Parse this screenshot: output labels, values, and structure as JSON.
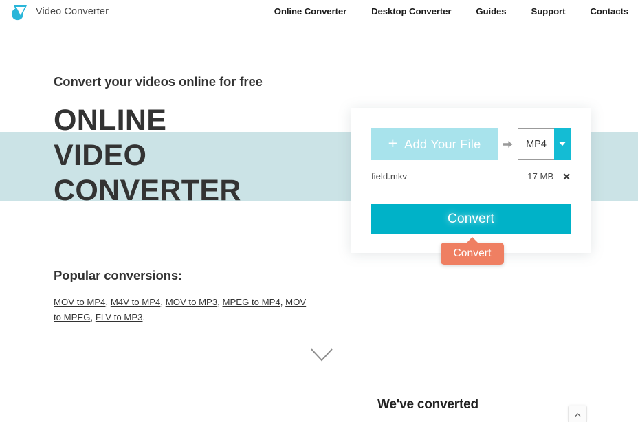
{
  "header": {
    "brand_name": "Video Converter",
    "logo_icon": "video-converter-logo",
    "nav": [
      {
        "label": "Online Converter"
      },
      {
        "label": "Desktop Converter"
      },
      {
        "label": "Guides"
      },
      {
        "label": "Support"
      },
      {
        "label": "Contacts"
      }
    ]
  },
  "hero": {
    "kicker": "Convert your videos online for free",
    "title_line1": "ONLINE",
    "title_line2": "VIDEO",
    "title_line3": "CONVERTER",
    "band_color": "#cbe3e6"
  },
  "popular": {
    "title": "Popular conversions:",
    "links": [
      {
        "label": "MOV to MP4"
      },
      {
        "label": "M4V to MP4"
      },
      {
        "label": "MOV to MP3"
      },
      {
        "label": "MPEG to MP4"
      },
      {
        "label": "MOV to MPEG"
      },
      {
        "label": "FLV to MP3"
      }
    ],
    "separator": ", ",
    "terminator": "."
  },
  "converter": {
    "add_file_label": "Add Your File",
    "add_file_plus": "+",
    "add_file_icon": "plus-icon",
    "arrow_icon": "arrow-right-icon",
    "format_value": "MP4",
    "format_caret_icon": "chevron-down-icon",
    "file": {
      "name": "field.mkv",
      "size": "17 MB",
      "remove_icon": "close-icon",
      "remove_label": "✕"
    },
    "convert_label": "Convert",
    "accent_color": "#00b2c8",
    "add_file_color": "#a8e3ec",
    "caret_color": "#14bcd4"
  },
  "tooltip": {
    "label": "Convert",
    "color": "#ef7f62"
  },
  "scroll_chevron_icon": "chevron-down-icon",
  "bottom": {
    "heading": "We've converted",
    "scroll_top_icon": "chevron-up-icon"
  }
}
